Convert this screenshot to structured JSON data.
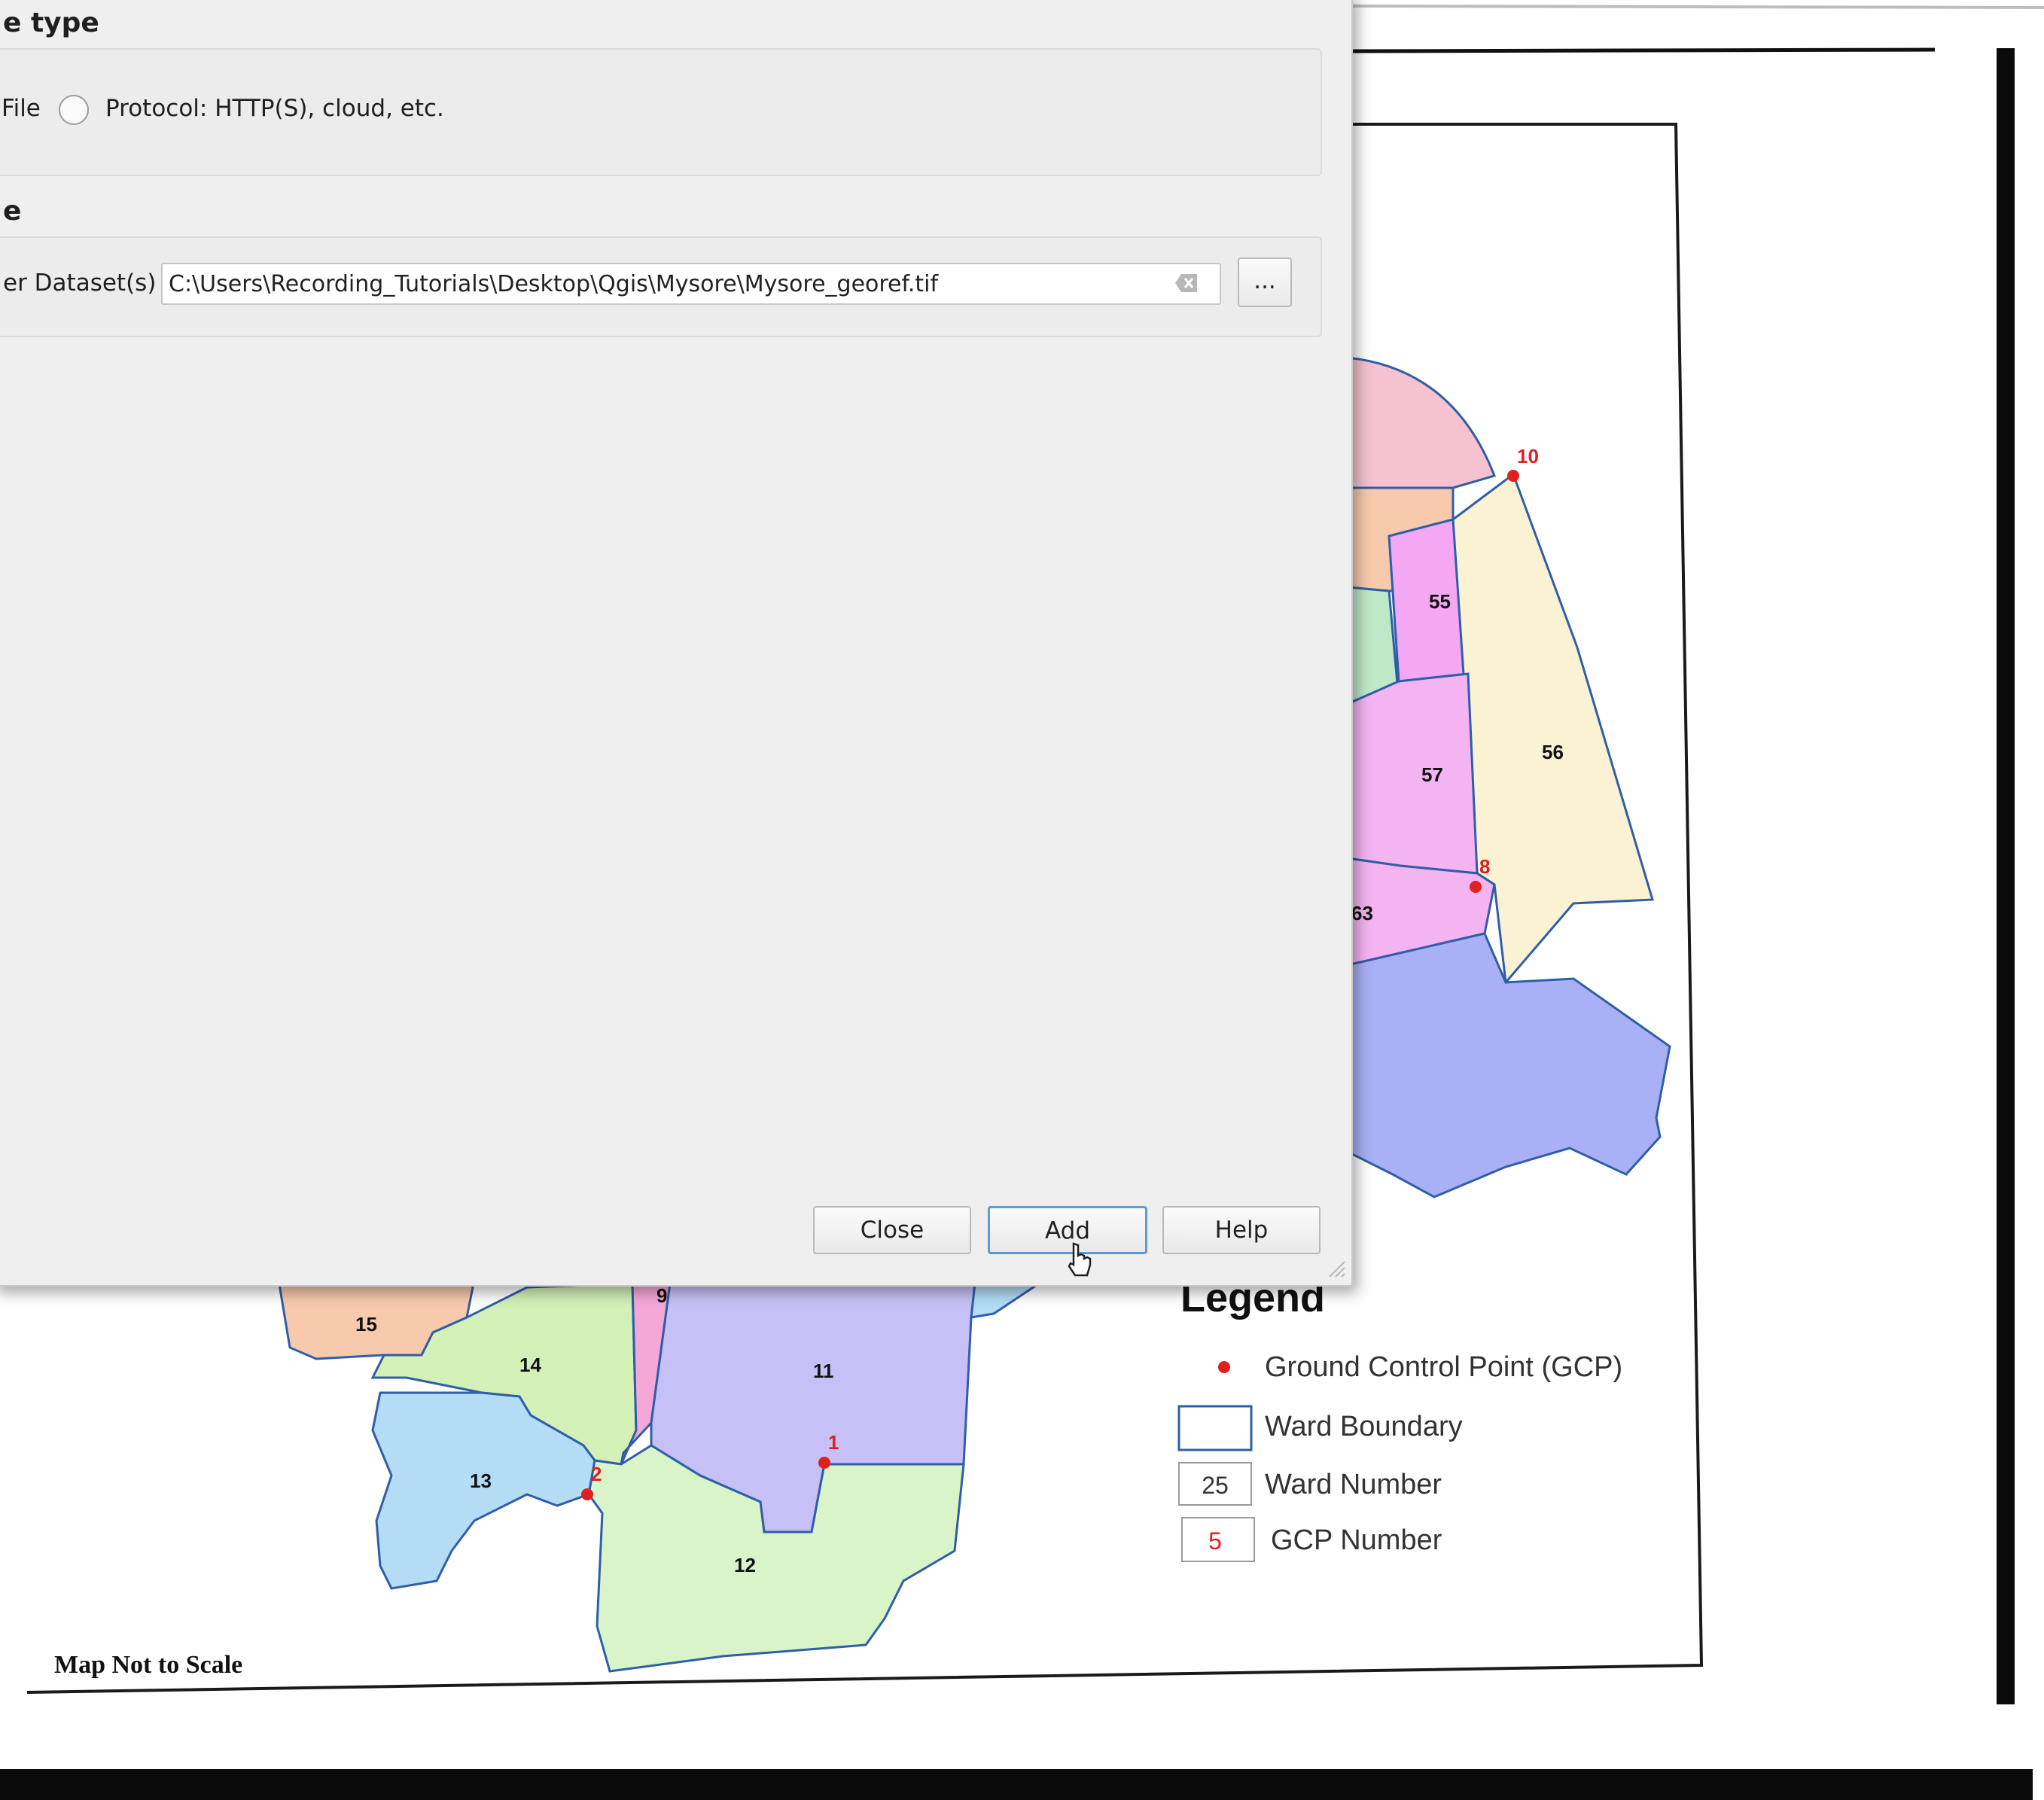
{
  "dialog": {
    "source_type_title": "e type",
    "file_label": "File",
    "protocol_label": "Protocol: HTTP(S), cloud, etc.",
    "source_title": "e",
    "dataset_label": "er Dataset(s)",
    "path_value": "C:\\Users\\Recording_Tutorials\\Desktop\\Qgis\\Mysore\\Mysore_georef.tif",
    "browse_label": "...",
    "close_label": "Close",
    "add_label": "Add",
    "help_label": "Help"
  },
  "map": {
    "ward_labels": [
      "55",
      "56",
      "57",
      "63",
      "9",
      "15",
      "14",
      "11",
      "13",
      "12"
    ],
    "gcp_labels": [
      "10",
      "8",
      "2",
      "1"
    ],
    "scale_note": "Map Not to Scale"
  },
  "legend": {
    "title": "Legend",
    "gcp": "Ground Control Point (GCP)",
    "ward_boundary": "Ward Boundary",
    "ward_number": "Ward Number",
    "ward_number_sample": "25",
    "gcp_number": "GCP Number",
    "gcp_number_sample": "5"
  },
  "colors": {
    "gcp_red": "#e0201f",
    "boundary_blue": "#2f5ea8",
    "default_button_border": "#5b9bdb"
  }
}
